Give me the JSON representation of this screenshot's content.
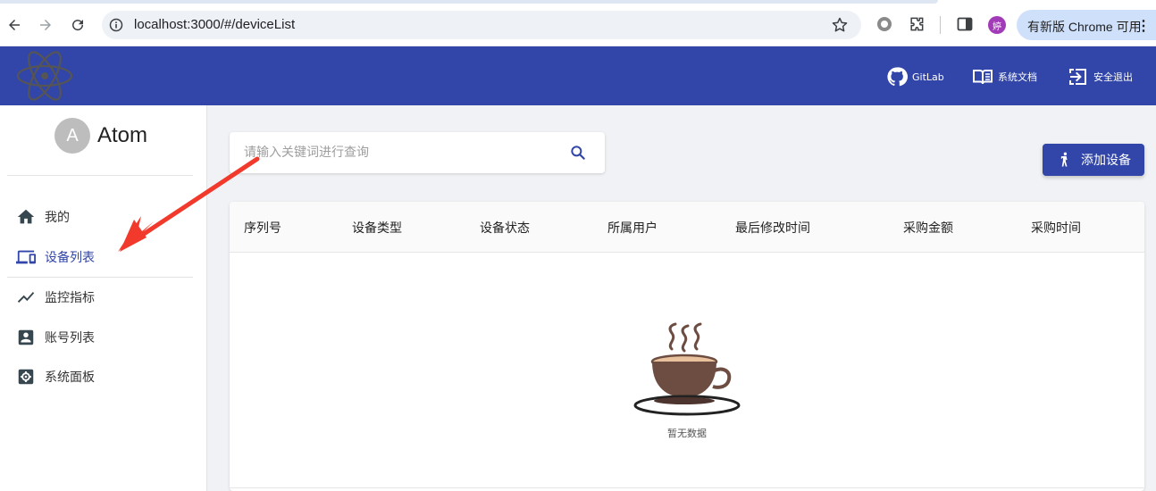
{
  "browser": {
    "url": "localhost:3000/#/deviceList",
    "profile_initial": "婷",
    "update_label": "有新版 Chrome 可用"
  },
  "header": {
    "links": [
      {
        "label": "GitLab",
        "icon": "github-icon"
      },
      {
        "label": "系统文档",
        "icon": "book-icon"
      },
      {
        "label": "安全退出",
        "icon": "logout-icon"
      }
    ]
  },
  "sidebar": {
    "user": {
      "initial": "A",
      "name": "Atom"
    },
    "items": [
      {
        "label": "我的",
        "icon": "home-icon",
        "active": false
      },
      {
        "label": "设备列表",
        "icon": "devices-icon",
        "active": true
      },
      {
        "label": "监控指标",
        "icon": "trend-icon",
        "active": false
      },
      {
        "label": "账号列表",
        "icon": "account-box-icon",
        "active": false
      },
      {
        "label": "系统面板",
        "icon": "settings-icon",
        "active": false
      }
    ]
  },
  "main": {
    "search_placeholder": "请输入关键词进行查询",
    "add_button": "添加设备",
    "columns": [
      "序列号",
      "设备类型",
      "设备状态",
      "所属用户",
      "最后修改时间",
      "采购金额",
      "采购时间"
    ],
    "empty_text": "暂无数据"
  },
  "colors": {
    "primary": "#3146a8",
    "annotation_arrow": "#f23a2c"
  }
}
